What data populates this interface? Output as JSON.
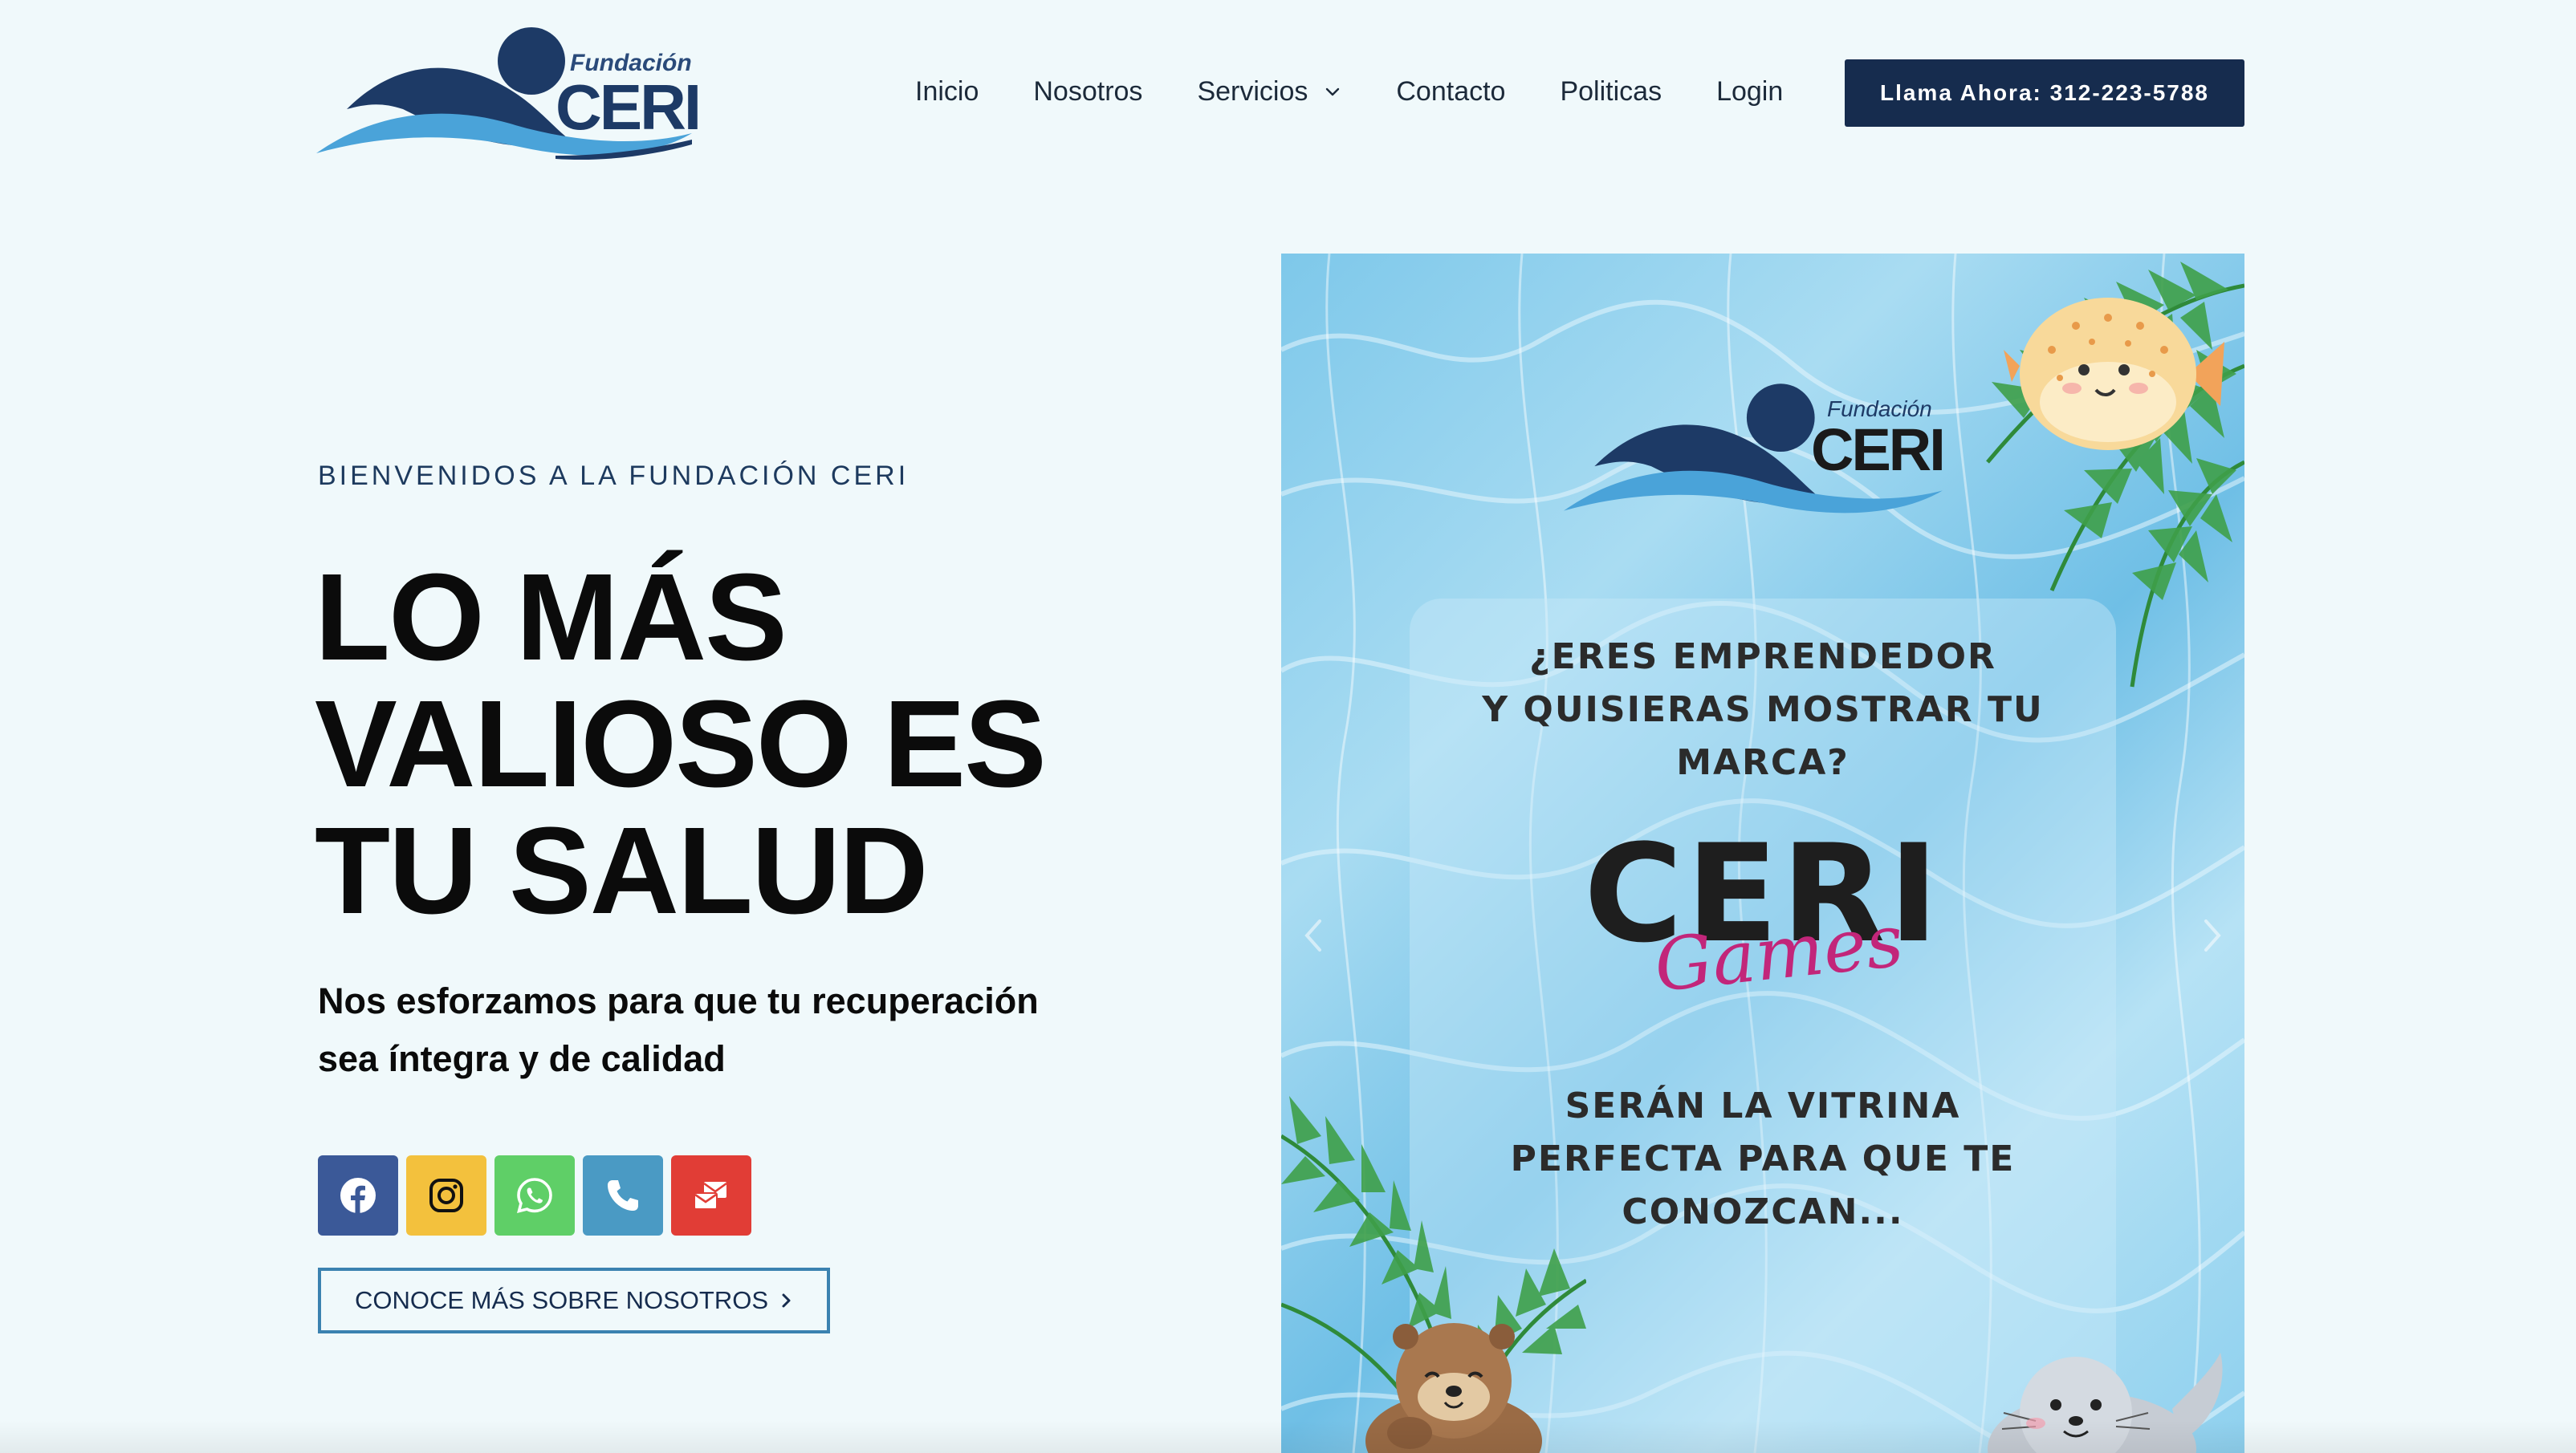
{
  "header": {
    "logo": {
      "small_text": "Fundación",
      "big_text": "CERI",
      "colors": {
        "navy": "#1d3a66",
        "light_blue": "#4aa3d9"
      }
    },
    "nav": [
      {
        "label": "Inicio"
      },
      {
        "label": "Nosotros"
      },
      {
        "label": "Servicios",
        "has_dropdown": true,
        "icon": "chevron-down-icon"
      },
      {
        "label": "Contacto"
      },
      {
        "label": "Politicas"
      },
      {
        "label": "Login"
      }
    ],
    "cta_label": "Llama Ahora: 312-223-5788",
    "cta_color": "#162c4e"
  },
  "hero": {
    "eyebrow": "BIENVENIDOS A LA FUNDACIÓN CERI",
    "title": "LO MÁS VALIOSO ES TU SALUD",
    "subtitle": "Nos esforzamos para que tu recuperación sea íntegra y de calidad",
    "social": [
      {
        "icon": "facebook-icon",
        "color": "#3b5998"
      },
      {
        "icon": "instagram-icon",
        "color": "#f3c13d"
      },
      {
        "icon": "whatsapp-icon",
        "color": "#5fcf67"
      },
      {
        "icon": "phone-icon",
        "color": "#4a9ac4"
      },
      {
        "icon": "email-icon",
        "color": "#e13d36"
      }
    ],
    "more_button_label": "CONOCE MÁS SOBRE NOSOTROS",
    "more_button_icon": "chevron-right-icon"
  },
  "slider": {
    "logo_small_text": "Fundación",
    "logo_big_text": "CERI",
    "question": "¿ERES EMPRENDEDOR\nY QUISIERAS MOSTRAR TU\nMARCA?",
    "brand": "CERI",
    "script": "Games",
    "tagline": "SERÁN LA VITRINA\nPERFECTA PARA QUE TE\nCONOZCAN...",
    "script_color": "#c2267a",
    "decorations": [
      "palm-leaves",
      "pufferfish",
      "otter",
      "seal"
    ]
  }
}
